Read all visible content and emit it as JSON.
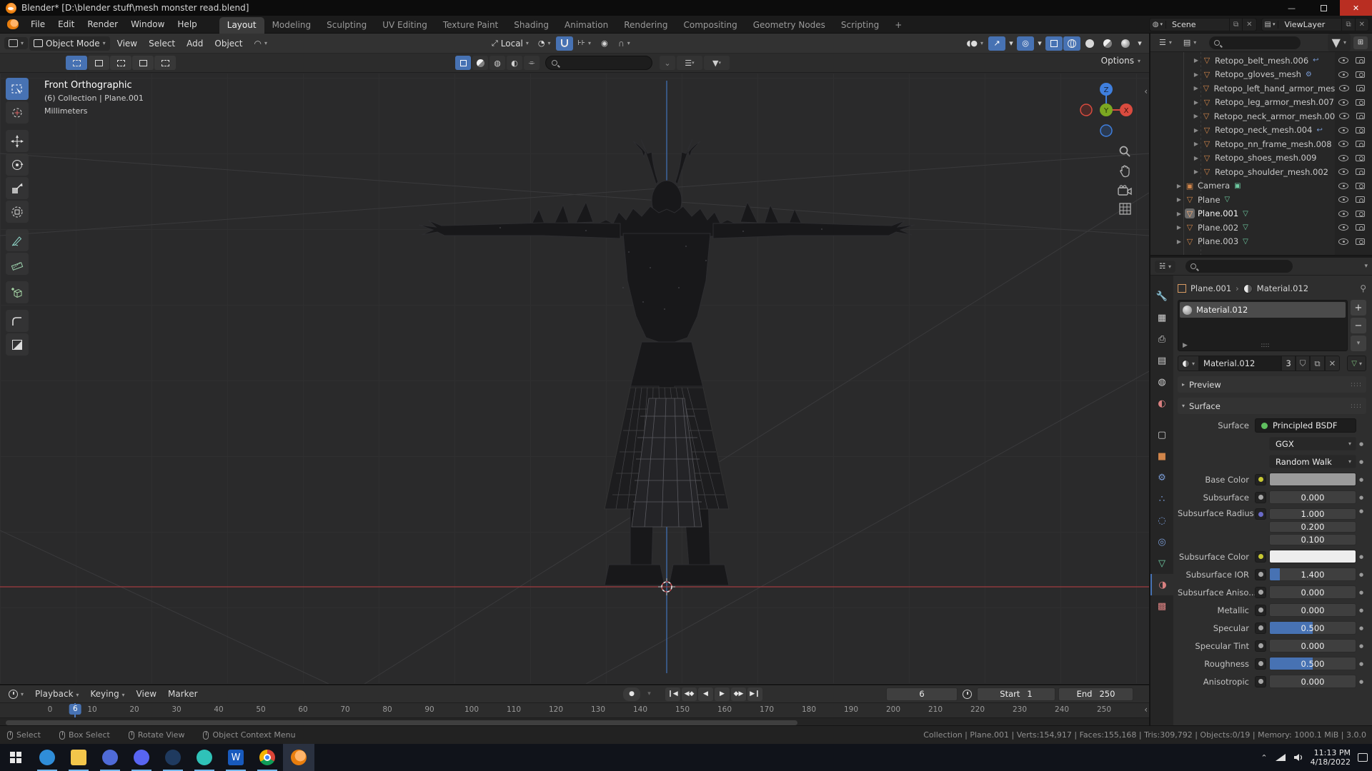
{
  "window": {
    "title": "Blender* [D:\\blender stuff\\mesh monster read.blend]"
  },
  "topbar": {
    "menus": [
      "File",
      "Edit",
      "Render",
      "Window",
      "Help"
    ],
    "workspaces": [
      "Layout",
      "Modeling",
      "Sculpting",
      "UV Editing",
      "Texture Paint",
      "Shading",
      "Animation",
      "Rendering",
      "Compositing",
      "Geometry Nodes",
      "Scripting"
    ],
    "active_workspace": "Layout",
    "add_workspace": "+",
    "scene_label": "Scene",
    "viewlayer_label": "ViewLayer"
  },
  "viewport": {
    "mode": "Object Mode",
    "menus": [
      "View",
      "Select",
      "Add",
      "Object"
    ],
    "orientation": "Local",
    "options_label": "Options",
    "overlay": {
      "view": "Front Orthographic",
      "context": "(6) Collection | Plane.001",
      "units": "Millimeters"
    },
    "gizmo": {
      "x": "X",
      "y": "Y",
      "z": "Z"
    }
  },
  "tools": [
    {
      "name": "select-box",
      "active": true,
      "gap": false
    },
    {
      "name": "cursor",
      "active": false,
      "gap": false
    },
    {
      "name": "move",
      "active": false,
      "gap": true
    },
    {
      "name": "rotate",
      "active": false,
      "gap": false
    },
    {
      "name": "scale",
      "active": false,
      "gap": false
    },
    {
      "name": "transform",
      "active": false,
      "gap": false
    },
    {
      "name": "annotate",
      "active": false,
      "gap": true
    },
    {
      "name": "measure",
      "active": false,
      "gap": false
    },
    {
      "name": "add-cube",
      "active": false,
      "gap": true
    },
    {
      "name": "rounded-corner",
      "active": false,
      "gap": true
    },
    {
      "name": "backdrop",
      "active": false,
      "gap": false
    }
  ],
  "outliner": {
    "items": [
      {
        "name": "Retopo_belt_mesh.006",
        "indent": 2,
        "icon": "mesh",
        "extra": "hook",
        "selected": false
      },
      {
        "name": "Retopo_gloves_mesh",
        "indent": 2,
        "icon": "mesh",
        "extra": "wrench",
        "selected": false
      },
      {
        "name": "Retopo_left_hand_armor_mes",
        "indent": 2,
        "icon": "mesh",
        "extra": "",
        "selected": false
      },
      {
        "name": "Retopo_leg_armor_mesh.007",
        "indent": 2,
        "icon": "mesh",
        "extra": "",
        "selected": false
      },
      {
        "name": "Retopo_neck_armor_mesh.00",
        "indent": 2,
        "icon": "mesh",
        "extra": "",
        "selected": false
      },
      {
        "name": "Retopo_neck_mesh.004",
        "indent": 2,
        "icon": "mesh",
        "extra": "hook",
        "selected": false
      },
      {
        "name": "Retopo_nn_frame_mesh.008",
        "indent": 2,
        "icon": "mesh",
        "extra": "",
        "selected": false
      },
      {
        "name": "Retopo_shoes_mesh.009",
        "indent": 2,
        "icon": "mesh",
        "extra": "",
        "selected": false
      },
      {
        "name": "Retopo_shoulder_mesh.002",
        "indent": 2,
        "icon": "mesh",
        "extra": "",
        "selected": false
      },
      {
        "name": "Camera",
        "indent": 1,
        "icon": "camera",
        "extra": "camera-data",
        "selected": false
      },
      {
        "name": "Plane",
        "indent": 1,
        "icon": "mesh",
        "extra": "mesh-data",
        "selected": false
      },
      {
        "name": "Plane.001",
        "indent": 1,
        "icon": "mesh",
        "extra": "mesh-data",
        "selected": true
      },
      {
        "name": "Plane.002",
        "indent": 1,
        "icon": "mesh",
        "extra": "mesh-data",
        "selected": false
      },
      {
        "name": "Plane.003",
        "indent": 1,
        "icon": "mesh",
        "extra": "mesh-data",
        "selected": false
      }
    ]
  },
  "properties": {
    "breadcrumb": {
      "object": "Plane.001",
      "material": "Material.012"
    },
    "slots": [
      {
        "name": "Material.012"
      }
    ],
    "datablock": {
      "name": "Material.012",
      "users": "3"
    },
    "preview_label": "Preview",
    "surface_panel_label": "Surface",
    "surface_label": "Surface",
    "surface_shader": "Principled BSDF",
    "rows": [
      {
        "label": "",
        "type": "dropdown",
        "value": "GGX",
        "socket": "none"
      },
      {
        "label": "",
        "type": "dropdown",
        "value": "Random Walk",
        "socket": "none"
      },
      {
        "label": "Base Color",
        "type": "color",
        "swatch": "#9b9b9b",
        "socket": "#c8c832"
      },
      {
        "label": "Subsurface",
        "type": "number",
        "value": "0.000",
        "fill": 0,
        "socket": "#a5a5a5"
      },
      {
        "label": "Subsurface Radius",
        "type": "vector",
        "values": [
          "1.000",
          "0.200",
          "0.100"
        ],
        "socket": "#6a6ac8"
      },
      {
        "label": "Subsurface Color",
        "type": "color",
        "swatch": "#ededed",
        "socket": "#c8c832"
      },
      {
        "label": "Subsurface IOR",
        "type": "number",
        "value": "1.400",
        "fill": 0.12,
        "socket": "#a5a5a5"
      },
      {
        "label": "Subsurface Aniso...",
        "type": "number",
        "value": "0.000",
        "fill": 0,
        "socket": "#a5a5a5"
      },
      {
        "label": "Metallic",
        "type": "number",
        "value": "0.000",
        "fill": 0,
        "socket": "#a5a5a5"
      },
      {
        "label": "Specular",
        "type": "number",
        "value": "0.500",
        "fill": 0.5,
        "socket": "#a5a5a5"
      },
      {
        "label": "Specular Tint",
        "type": "number",
        "value": "0.000",
        "fill": 0,
        "socket": "#a5a5a5"
      },
      {
        "label": "Roughness",
        "type": "number",
        "value": "0.500",
        "fill": 0.5,
        "socket": "#a5a5a5"
      },
      {
        "label": "Anisotropic",
        "type": "number",
        "value": "0.000",
        "fill": 0,
        "socket": "#a5a5a5"
      }
    ]
  },
  "timeline": {
    "menus": [
      "Playback",
      "Keying",
      "View",
      "Marker"
    ],
    "current_frame": "6",
    "start_label": "Start",
    "start_value": "1",
    "end_label": "End",
    "end_value": "250",
    "ticks": [
      0,
      10,
      20,
      30,
      40,
      50,
      60,
      70,
      80,
      90,
      100,
      110,
      120,
      130,
      140,
      150,
      160,
      170,
      180,
      190,
      200,
      210,
      220,
      230,
      240,
      250
    ]
  },
  "statusbar": {
    "hints": [
      "Select",
      "Box Select",
      "Rotate View",
      "Object Context Menu"
    ],
    "info": "Collection | Plane.001 | Verts:154,917 | Faces:155,168 | Tris:309,792 | Objects:0/19 | Memory: 1000.1 MiB | 3.0.0"
  },
  "taskbar": {
    "apps": [
      {
        "name": "edge",
        "color": "#2f8dd8",
        "active": false
      },
      {
        "name": "file-explorer",
        "color": "#f3c64b",
        "active": false
      },
      {
        "name": "media-player",
        "color": "#4f6bd8",
        "active": false
      },
      {
        "name": "discord",
        "color": "#5865f2",
        "active": false
      },
      {
        "name": "steam",
        "color": "#1f3a5f",
        "active": false
      },
      {
        "name": "music-app",
        "color": "#2fc2b8",
        "active": false
      },
      {
        "name": "word",
        "color": "#185abd",
        "active": false
      },
      {
        "name": "chrome",
        "color": "#d94f3d",
        "active": false
      },
      {
        "name": "blender",
        "color": "#e87d0d",
        "active": true
      }
    ],
    "time": "11:13 PM",
    "date": "4/18/2022"
  },
  "colors": {
    "accent": "#4772b3",
    "axis_x": "#a03c40",
    "axis_z": "#3f69a8"
  }
}
